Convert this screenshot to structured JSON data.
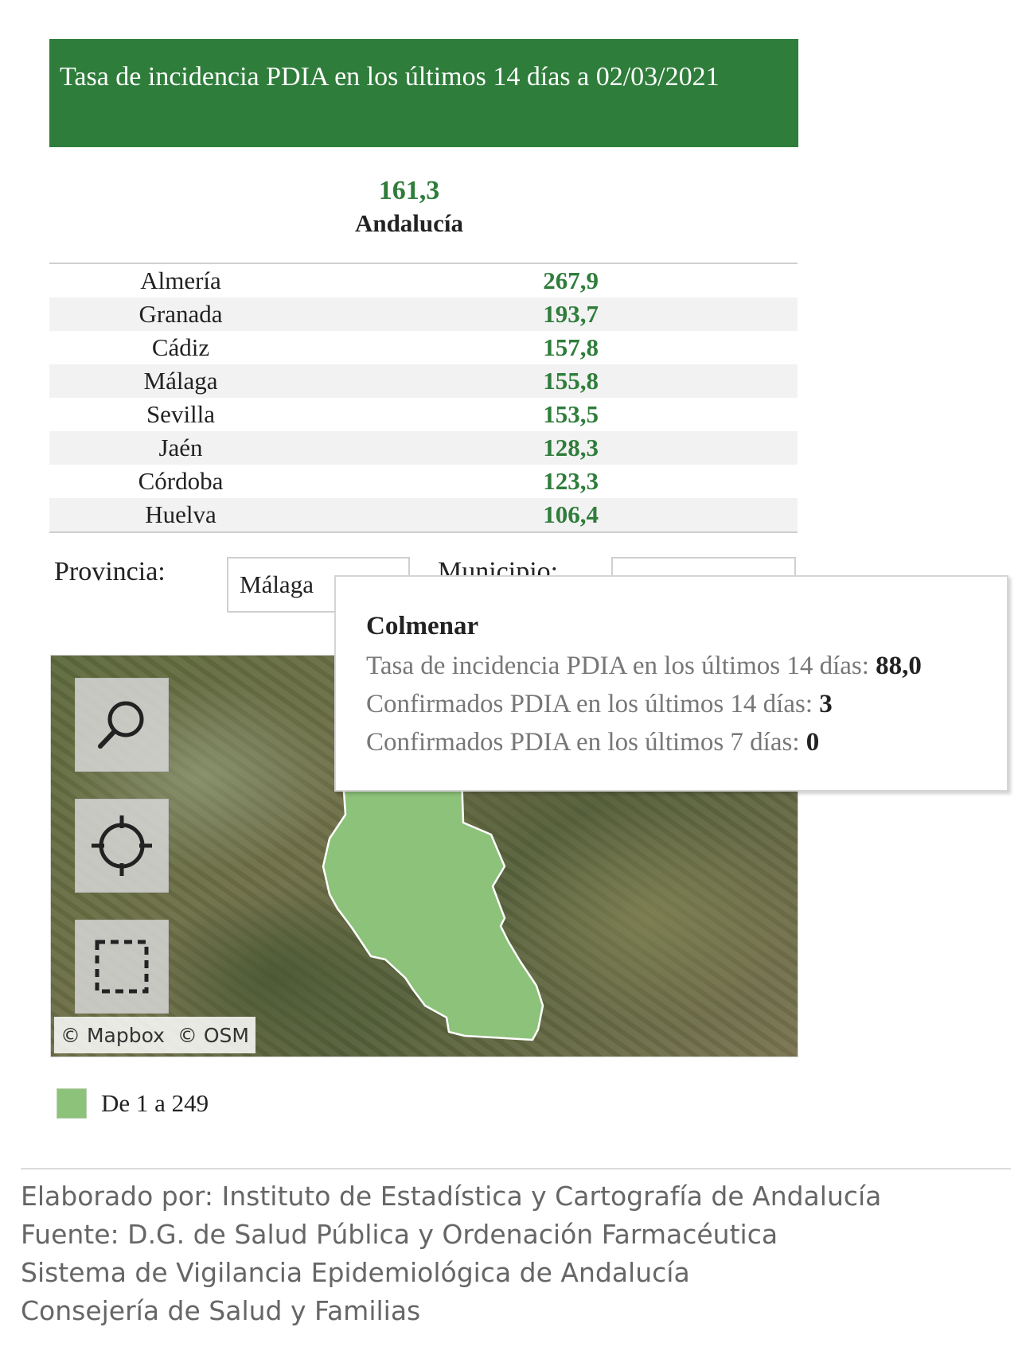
{
  "header": {
    "title": "Tasa de incidencia PDIA en los últimos 14 días a 02/03/2021"
  },
  "total": {
    "value": "161,3",
    "name": "Andalucía"
  },
  "provinces": [
    {
      "name": "Almería",
      "value": "267,9"
    },
    {
      "name": "Granada",
      "value": "193,7"
    },
    {
      "name": "Cádiz",
      "value": "157,8"
    },
    {
      "name": "Málaga",
      "value": "155,8"
    },
    {
      "name": "Sevilla",
      "value": "153,5"
    },
    {
      "name": "Jaén",
      "value": "128,3"
    },
    {
      "name": "Córdoba",
      "value": "123,3"
    },
    {
      "name": "Huelva",
      "value": "106,4"
    }
  ],
  "filters": {
    "province_label": "Provincia:",
    "province_value": "Málaga",
    "municipality_label": "Municipio:",
    "municipality_value": ""
  },
  "map": {
    "attribution_mapbox": "© Mapbox",
    "attribution_osm": "© OSM",
    "area_color": "#8dc27a",
    "controls": [
      "search-icon",
      "locate-icon",
      "select-area-icon"
    ]
  },
  "tooltip": {
    "title": "Colmenar",
    "line1_label": "Tasa de incidencia PDIA en los últimos 14 días: ",
    "line1_value": "88,0",
    "line2_label": "Confirmados PDIA en los últimos 14 días: ",
    "line2_value": "3",
    "line3_label": "Confirmados PDIA en los últimos 7 días: ",
    "line3_value": "0"
  },
  "legend": {
    "label": "De 1 a 249",
    "color": "#8dc27a"
  },
  "footer": {
    "line1": "Elaborado por: Instituto de Estadística y Cartografía de Andalucía",
    "line2": "Fuente: D.G. de Salud Pública y Ordenación Farmacéutica",
    "line3": "Sistema de Vigilancia Epidemiológica de Andalucía",
    "line4": "Consejería de Salud y Familias"
  },
  "colors": {
    "accent": "#2f7d3b"
  }
}
